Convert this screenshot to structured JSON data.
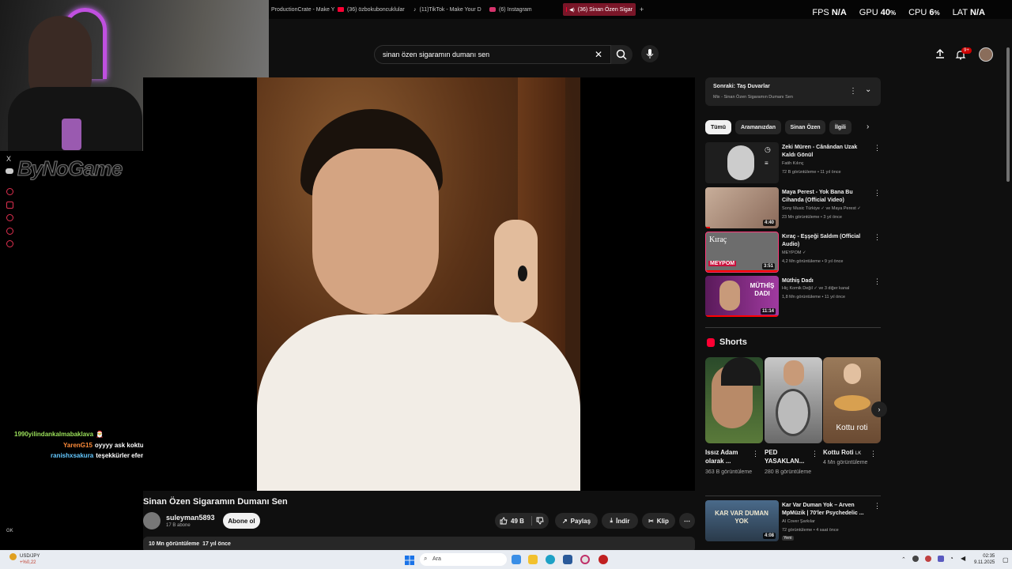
{
  "browser": {
    "tabs": [
      {
        "label": "ProductionCrate - Make Y"
      },
      {
        "label": "(36) özbokuboncuklular"
      },
      {
        "label": "(11)TikTok - Make Your D"
      },
      {
        "label": "(6) Instagram"
      },
      {
        "label": "(36) Sinan Özen Sigar"
      }
    ],
    "new_tab": "+"
  },
  "hud": {
    "fps_label": "FPS",
    "fps_value": "N/A",
    "gpu_label": "GPU",
    "gpu_value": "40",
    "cpu_label": "CPU",
    "cpu_value": "6",
    "pct": "%",
    "lat_label": "LAT",
    "lat_value": "N/A"
  },
  "stream": {
    "logo": "ByNoGame",
    "x_icon": "X",
    "chat": [
      {
        "user": "1990yilindankalmabaklava",
        "user_color": "#9be05a",
        "msg": ""
      },
      {
        "user": "YarenG15",
        "user_color": "#ff8c3a",
        "msg": "oyyyy ask koktuuuuu"
      },
      {
        "user": "ranishxsakura",
        "user_color": "#64c8ff",
        "msg": "teşekkürler efem"
      }
    ],
    "gk_label": "GK"
  },
  "youtube": {
    "search_value": "sinan özen sigaramın dumanı sen",
    "notifications": "9+",
    "video": {
      "title": "Sinan Özen Sigaramın Dumanı Sen",
      "channel": "suleyman5893",
      "subscribers": "17 B abone",
      "subscribe_label": "Abone ol",
      "likes": "49 B",
      "share_label": "Paylaş",
      "download_label": "İndir",
      "clip_label": "Klip",
      "views": "10 Mn görüntüleme",
      "age": "17 yıl önce"
    },
    "mix": {
      "next_label": "Sonraki: Taş Duvarlar",
      "sub_label": "Mix - Sinan Özen Sigaramın Dumanı Sen"
    },
    "chips": [
      "Tümü",
      "Aramanızdan",
      "Sinan Özen",
      "İlgili"
    ],
    "recommendations": [
      {
        "title": "Zeki Müren - Cânândan Uzak Kaldı Gönül",
        "channel": "Fatih Kılınç",
        "meta": "72 B görüntüleme • 11 yıl önce",
        "duration": "",
        "thumb_color": "#2a2a2a"
      },
      {
        "title": "Maya Perest  - Yok Bana Bu Cihanda (Official Video)",
        "channel": "Sony Music Türkiye ✓ ve Maya Perest ✓",
        "meta": "23 Mn görüntüleme • 3 yıl önce",
        "duration": "4:40",
        "thumb_color": "#b89a88"
      },
      {
        "title": "Kıraç - Eşşeği Saldım (Official Audio)",
        "channel": "MEYPOM ✓",
        "meta": "4,2 Mn görüntüleme • 9 yıl önce",
        "duration": "3:51",
        "thumb_color": "#8c8c8c",
        "overlay": "Kıraç",
        "badge": "MEYPOM"
      },
      {
        "title": "Müthiş Dadı",
        "channel": "Hiç Komik Değil ✓ ve 3 diğer kanal",
        "meta": "1,8 Mn görüntüleme • 11 yıl önce",
        "duration": "11:14",
        "thumb_color": "#7a2a7a",
        "overlay": "MÜTHİŞ DADI"
      }
    ],
    "shorts": {
      "title": "Shorts",
      "items": [
        {
          "title": "Issız Adam olarak ...",
          "views": "363 B görüntüleme",
          "color": "#3a5a2a"
        },
        {
          "title": "PED YASAKLAN...",
          "views": "280 B görüntüleme",
          "color": "#8a8a8a"
        },
        {
          "title": "Kottu Roti",
          "tag": "LK",
          "views": "4 Mn görüntüleme",
          "color": "#9a7050",
          "overlay": "Kottu roti"
        }
      ]
    },
    "rec_bottom": {
      "title": "Kar Var Duman Yok – Arven MpMüzik | 70'ler Psychedelic ...",
      "channel": "AI Cover Şarkılar",
      "meta": "72 görüntüleme • 4 saat önce",
      "badge": "Yeni",
      "duration": "4:08",
      "overlay": "KAR VAR DUMAN YOK"
    }
  },
  "taskbar": {
    "ticker_symbol": "USD/JPY",
    "ticker_change": "+%0,22",
    "search_placeholder": "Ara",
    "time": "02:35",
    "date": "9.11.2025"
  }
}
